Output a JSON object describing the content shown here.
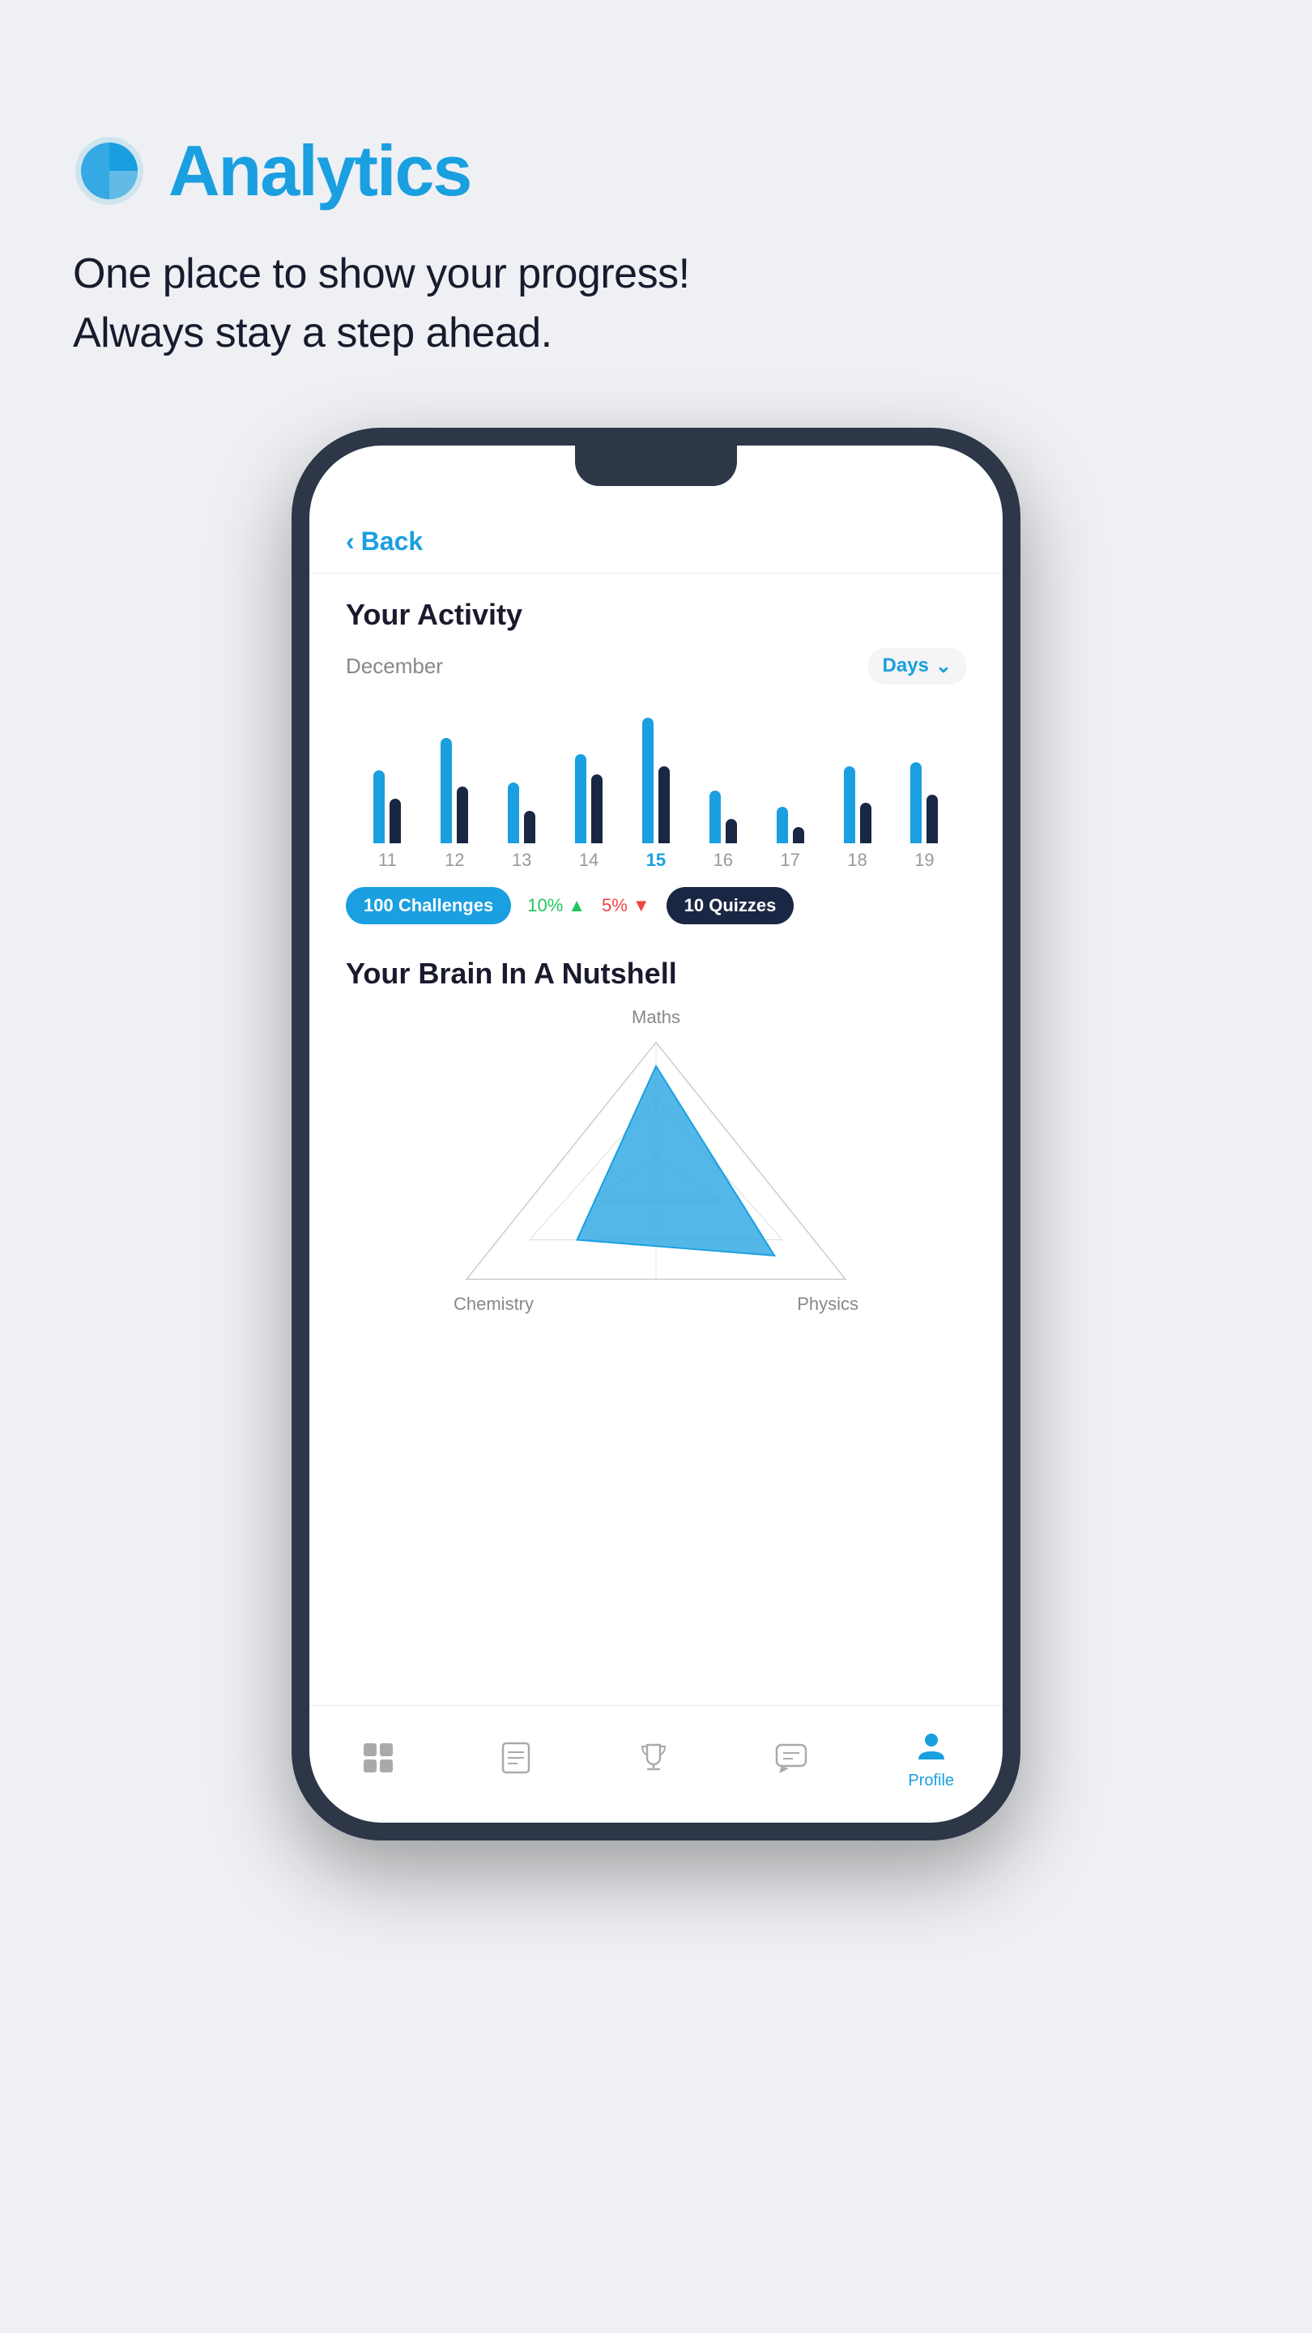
{
  "page": {
    "background_color": "#eef0f3"
  },
  "header": {
    "icon_label": "analytics-pie-icon",
    "title": "Analytics",
    "tagline_line1": "One place to show your progress!",
    "tagline_line2": "Always stay a step ahead."
  },
  "phone": {
    "back_button_label": "Back",
    "activity_section": {
      "title": "Your Activity",
      "month": "December",
      "filter_label": "Days",
      "chart_bars": [
        {
          "day": "11",
          "active": false,
          "bars": [
            {
              "height": 90,
              "type": "blue"
            },
            {
              "height": 55,
              "type": "dark"
            }
          ]
        },
        {
          "day": "12",
          "active": false,
          "bars": [
            {
              "height": 130,
              "type": "blue"
            },
            {
              "height": 70,
              "type": "dark"
            }
          ]
        },
        {
          "day": "13",
          "active": false,
          "bars": [
            {
              "height": 75,
              "type": "blue"
            },
            {
              "height": 40,
              "type": "dark"
            }
          ]
        },
        {
          "day": "14",
          "active": false,
          "bars": [
            {
              "height": 110,
              "type": "blue"
            },
            {
              "height": 85,
              "type": "dark"
            }
          ]
        },
        {
          "day": "15",
          "active": true,
          "bars": [
            {
              "height": 155,
              "type": "blue"
            },
            {
              "height": 95,
              "type": "dark"
            }
          ]
        },
        {
          "day": "16",
          "active": false,
          "bars": [
            {
              "height": 65,
              "type": "blue"
            },
            {
              "height": 30,
              "type": "dark"
            }
          ]
        },
        {
          "day": "17",
          "active": false,
          "bars": [
            {
              "height": 45,
              "type": "blue"
            },
            {
              "height": 20,
              "type": "dark"
            }
          ]
        },
        {
          "day": "18",
          "active": false,
          "bars": [
            {
              "height": 95,
              "type": "blue"
            },
            {
              "height": 50,
              "type": "dark"
            }
          ]
        },
        {
          "day": "19",
          "active": false,
          "bars": [
            {
              "height": 100,
              "type": "blue"
            },
            {
              "height": 60,
              "type": "dark"
            }
          ]
        }
      ],
      "stats": {
        "challenges_count": "100",
        "challenges_label": "Challenges",
        "percent_up": "10%",
        "percent_up_direction": "up",
        "percent_down": "5%",
        "percent_down_direction": "down",
        "quizzes_count": "10",
        "quizzes_label": "Quizzes"
      }
    },
    "brain_section": {
      "title": "Your Brain In A Nutshell",
      "labels": {
        "top": "Maths",
        "bottom_left": "Chemistry",
        "bottom_right": "Physics"
      }
    },
    "bottom_nav": {
      "items": [
        {
          "id": "home",
          "label": "",
          "active": false
        },
        {
          "id": "lessons",
          "label": "",
          "active": false
        },
        {
          "id": "trophy",
          "label": "",
          "active": false
        },
        {
          "id": "chat",
          "label": "",
          "active": false
        },
        {
          "id": "profile",
          "label": "Profile",
          "active": true
        }
      ]
    }
  }
}
